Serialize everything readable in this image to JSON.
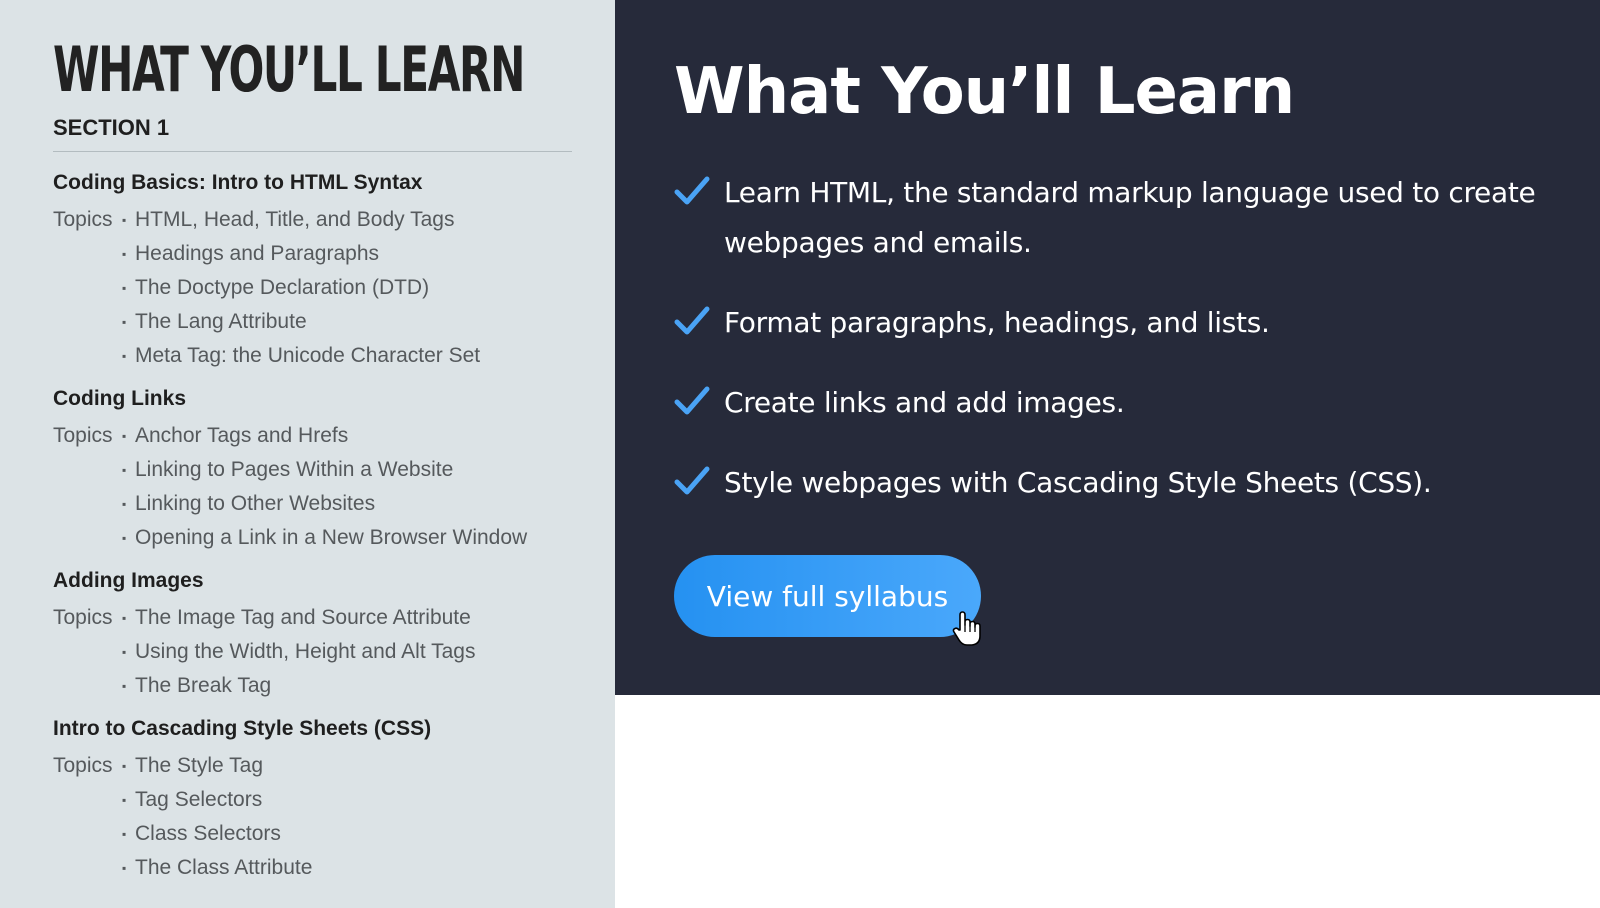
{
  "syllabus": {
    "title": "WHAT YOU’LL LEARN",
    "section_label": "SECTION 1",
    "topics_label": "Topics",
    "bullet": "▪",
    "modules": [
      {
        "title": "Coding Basics: Intro to HTML Syntax",
        "topics": [
          "HTML, Head, Title, and Body Tags",
          "Headings and Paragraphs",
          "The Doctype Declaration (DTD)",
          "The Lang Attribute",
          "Meta Tag: the Unicode Character Set"
        ]
      },
      {
        "title": "Coding Links",
        "topics": [
          "Anchor Tags and Hrefs",
          "Linking to Pages Within a Website",
          "Linking to Other Websites",
          "Opening a Link in a New Browser Window"
        ]
      },
      {
        "title": "Adding Images",
        "topics": [
          "The Image Tag and Source Attribute",
          "Using the Width, Height and Alt Tags",
          "The Break Tag"
        ]
      },
      {
        "title": "Intro to Cascading Style Sheets (CSS)",
        "topics": [
          "The Style Tag",
          "Tag Selectors",
          "Class Selectors",
          "The Class Attribute"
        ]
      }
    ]
  },
  "overview": {
    "title": "What You’ll Learn",
    "check_icon": "checkmark-icon",
    "benefits": [
      "Learn HTML, the standard markup language used to create webpages and emails.",
      "Format paragraphs, headings, and lists.",
      "Create links and add images.",
      "Style webpages with Cascading Style Sheets (CSS)."
    ],
    "cta_label": "View full syllabus",
    "cursor_icon": "hand-pointer-icon"
  },
  "colors": {
    "left_background": "#dce3e6",
    "right_background": "#262a3a",
    "check": "#4aa3f5",
    "button": "#2e97f5",
    "heading_dark": "#222222",
    "topic_text": "#55595c"
  }
}
